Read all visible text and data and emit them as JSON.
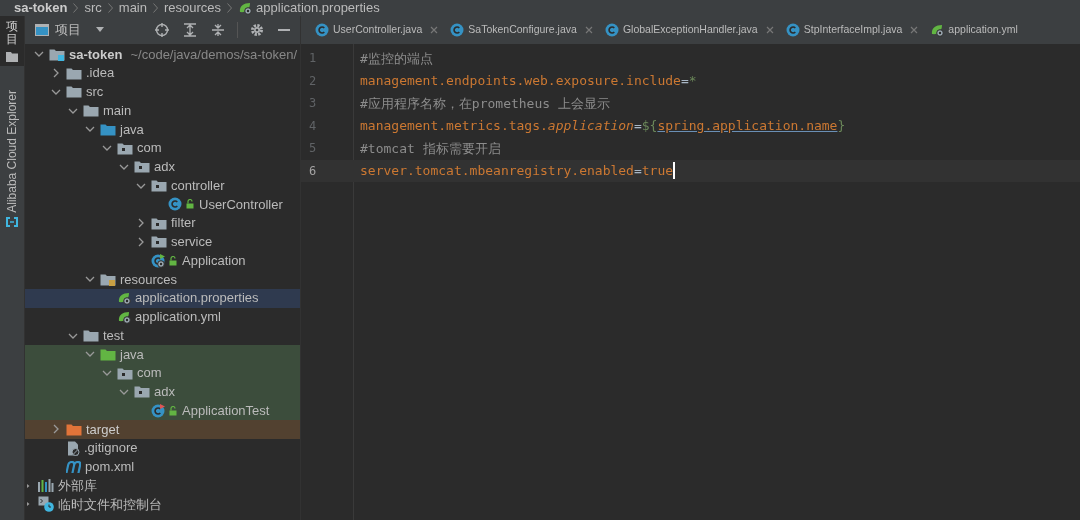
{
  "breadcrumb": [
    {
      "label": "sa-token",
      "bold": true,
      "kind": "text"
    },
    {
      "label": "src",
      "bold": false,
      "kind": "text"
    },
    {
      "label": "main",
      "bold": false,
      "kind": "text"
    },
    {
      "label": "resources",
      "bold": false,
      "kind": "text"
    },
    {
      "label": "application.properties",
      "bold": false,
      "kind": "spring"
    }
  ],
  "side_strip": [
    {
      "label": "项目",
      "kind": "cjk",
      "selected": true
    },
    {
      "label": "Alibaba Cloud Explorer",
      "kind": "latin",
      "selected": false
    }
  ],
  "project_panel": {
    "title": "项目"
  },
  "tree": [
    {
      "label": "sa-token",
      "path": "~/code/java/demos/sa-token/",
      "kind": "module",
      "expanded": true,
      "selected": false,
      "test_scope": false,
      "children": [
        {
          "label": ".idea",
          "kind": "folder",
          "expanded": false,
          "selected": false,
          "test_scope": false
        },
        {
          "label": "src",
          "kind": "folder",
          "expanded": true,
          "selected": false,
          "test_scope": false,
          "children": [
            {
              "label": "main",
              "kind": "folder",
              "expanded": true,
              "selected": false,
              "test_scope": false,
              "children": [
                {
                  "label": "java",
                  "kind": "source-folder",
                  "expanded": true,
                  "selected": false,
                  "test_scope": false,
                  "children": [
                    {
                      "label": "com",
                      "kind": "package",
                      "expanded": true,
                      "selected": false,
                      "test_scope": false,
                      "children": [
                        {
                          "label": "adx",
                          "kind": "package",
                          "expanded": true,
                          "selected": false,
                          "test_scope": false,
                          "children": [
                            {
                              "label": "controller",
                              "kind": "package",
                              "expanded": true,
                              "selected": false,
                              "test_scope": false,
                              "children": [
                                {
                                  "label": "UserController",
                                  "kind": "class",
                                  "selected": false,
                                  "test_scope": false
                                }
                              ]
                            },
                            {
                              "label": "filter",
                              "kind": "package",
                              "expanded": false,
                              "selected": false,
                              "test_scope": false
                            },
                            {
                              "label": "service",
                              "kind": "package",
                              "expanded": false,
                              "selected": false,
                              "test_scope": false
                            },
                            {
                              "label": "Application",
                              "kind": "boot-class",
                              "selected": false,
                              "test_scope": false
                            }
                          ]
                        }
                      ]
                    }
                  ]
                },
                {
                  "label": "resources",
                  "kind": "resource-folder",
                  "expanded": true,
                  "selected": false,
                  "test_scope": false,
                  "children": [
                    {
                      "label": "application.properties",
                      "kind": "spring-file",
                      "selected": true,
                      "test_scope": false
                    },
                    {
                      "label": "application.yml",
                      "kind": "spring-file",
                      "selected": false,
                      "test_scope": false
                    }
                  ]
                }
              ]
            },
            {
              "label": "test",
              "kind": "folder",
              "expanded": true,
              "selected": false,
              "test_scope": false,
              "children": [
                {
                  "label": "java",
                  "kind": "test-folder",
                  "expanded": true,
                  "selected": false,
                  "test_scope": true,
                  "children": [
                    {
                      "label": "com",
                      "kind": "package",
                      "expanded": true,
                      "selected": false,
                      "test_scope": true,
                      "children": [
                        {
                          "label": "adx",
                          "kind": "package",
                          "expanded": true,
                          "selected": false,
                          "test_scope": true,
                          "children": [
                            {
                              "label": "ApplicationTest",
                              "kind": "test-class",
                              "selected": false,
                              "test_scope": true
                            }
                          ]
                        }
                      ]
                    }
                  ]
                }
              ]
            }
          ]
        },
        {
          "label": "target",
          "kind": "excluded-folder",
          "expanded": false,
          "selected": false,
          "test_scope": false
        },
        {
          "label": ".gitignore",
          "kind": "ignore-file",
          "selected": false,
          "test_scope": false
        },
        {
          "label": "pom.xml",
          "kind": "maven-file",
          "selected": false,
          "test_scope": false
        }
      ]
    },
    {
      "label": "外部库",
      "kind": "libraries",
      "expanded": false,
      "selected": false,
      "test_scope": false
    },
    {
      "label": "临时文件和控制台",
      "kind": "scratches",
      "expanded": false,
      "selected": false,
      "test_scope": false
    }
  ],
  "tabs": [
    {
      "label": "UserController.java",
      "kind": "class",
      "selected": false,
      "close_visible": true
    },
    {
      "label": "SaTokenConfigure.java",
      "kind": "class",
      "selected": false,
      "close_visible": true
    },
    {
      "label": "GlobalExceptionHandler.java",
      "kind": "class",
      "selected": false,
      "close_visible": true
    },
    {
      "label": "StpInterfaceImpl.java",
      "kind": "class",
      "selected": false,
      "close_visible": true
    },
    {
      "label": "application.yml",
      "kind": "spring",
      "selected": false,
      "close_visible": false
    }
  ],
  "editor": {
    "lines": [
      {
        "number": "1",
        "current": false,
        "tokens": [
          {
            "text": "#监控的端点",
            "kind": "comment"
          }
        ]
      },
      {
        "number": "2",
        "current": false,
        "tokens": [
          {
            "text": "management.endpoints.web.exposure.include",
            "kind": "key"
          },
          {
            "text": "=",
            "kind": "op"
          },
          {
            "text": "*",
            "kind": "value"
          }
        ]
      },
      {
        "number": "3",
        "current": false,
        "tokens": [
          {
            "text": "#应用程序名称，在prometheus 上会显示",
            "kind": "comment"
          }
        ]
      },
      {
        "number": "4",
        "current": false,
        "tokens": [
          {
            "text": "management.metrics.tags.",
            "kind": "key"
          },
          {
            "text": "application",
            "kind": "key-italic"
          },
          {
            "text": "=",
            "kind": "op"
          },
          {
            "text": "${",
            "kind": "value"
          },
          {
            "text": "spring.application.name",
            "kind": "ref"
          },
          {
            "text": "}",
            "kind": "value"
          }
        ]
      },
      {
        "number": "5",
        "current": false,
        "tokens": [
          {
            "text": "#tomcat 指标需要开启",
            "kind": "comment"
          }
        ]
      },
      {
        "number": "6",
        "current": true,
        "tokens": [
          {
            "text": "server.tomcat.mbeanregistry.enabled",
            "kind": "key"
          },
          {
            "text": "=",
            "kind": "op"
          },
          {
            "text": "true",
            "kind": "key"
          }
        ]
      }
    ]
  }
}
